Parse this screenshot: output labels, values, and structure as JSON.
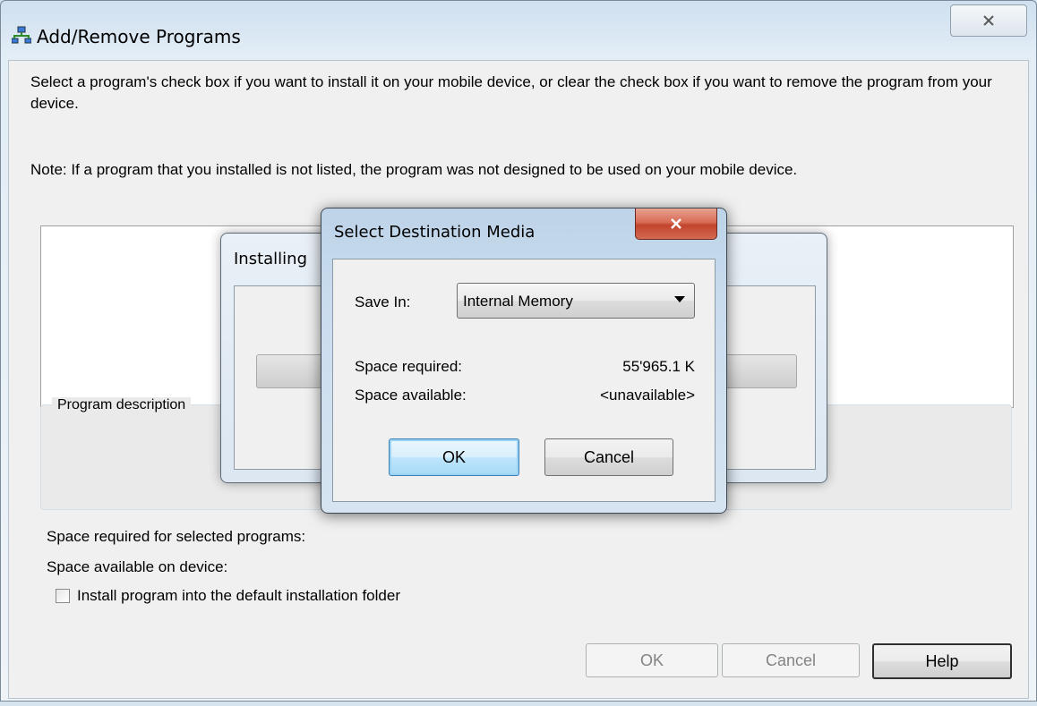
{
  "main_window": {
    "title": "Add/Remove Programs",
    "intro_text": "Select a program's check box if you want to install it on your mobile device, or clear the check box if you want to remove the program from your device.",
    "note_text": "Note:  If a program that you installed is not listed, the program was not designed to be used on your mobile device.",
    "program_description_label": "Program description",
    "space_required_label": "Space required for selected programs:",
    "space_available_label": "Space available on device:",
    "install_default_folder_label": "Install program into the default installation folder",
    "install_default_folder_checked": false,
    "buttons": {
      "ok": "OK",
      "cancel": "Cancel",
      "help": "Help"
    }
  },
  "installing_dialog": {
    "title": "Installing"
  },
  "destination_dialog": {
    "title": "Select Destination Media",
    "save_in_label": "Save In:",
    "save_in_value": "Internal Memory",
    "space_required_label": "Space required:",
    "space_required_value": "55'965.1 K",
    "space_available_label": "Space available:",
    "space_available_value": "<unavailable>",
    "ok_label": "OK",
    "cancel_label": "Cancel"
  },
  "icons": {
    "app": "network-computers-icon",
    "close": "close-icon",
    "dropdown": "chevron-down-icon"
  }
}
